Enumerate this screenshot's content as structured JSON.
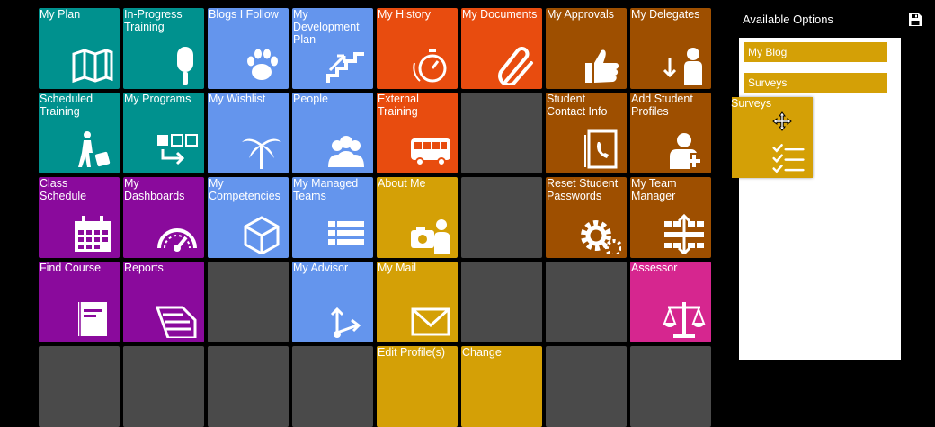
{
  "tiles": [
    {
      "id": "my-plan",
      "label": "My Plan",
      "color": "#00918e",
      "col": 0,
      "row": 0,
      "icon": "map-icon"
    },
    {
      "id": "in-progress-training",
      "label": "In-Progress Training",
      "color": "#00918e",
      "col": 1,
      "row": 0,
      "icon": "popsicle-icon"
    },
    {
      "id": "blogs-i-follow",
      "label": "Blogs I Follow",
      "color": "#6495ed",
      "col": 2,
      "row": 0,
      "icon": "paw-icon"
    },
    {
      "id": "my-development-plan",
      "label": "My Development Plan",
      "color": "#6495ed",
      "col": 3,
      "row": 0,
      "icon": "stairs-icon"
    },
    {
      "id": "my-history",
      "label": "My History",
      "color": "#e84c0f",
      "col": 4,
      "row": 0,
      "icon": "stopwatch-icon"
    },
    {
      "id": "my-documents",
      "label": "My Documents",
      "color": "#e84c0f",
      "col": 5,
      "row": 0,
      "icon": "paperclip-icon"
    },
    {
      "id": "my-approvals",
      "label": "My Approvals",
      "color": "#9e4f00",
      "col": 6,
      "row": 0,
      "icon": "thumbs-up-icon"
    },
    {
      "id": "my-delegates",
      "label": "My Delegates",
      "color": "#9e4f00",
      "col": 7,
      "row": 0,
      "icon": "person-download-icon"
    },
    {
      "id": "scheduled-training",
      "label": "Scheduled Training",
      "color": "#00918e",
      "col": 0,
      "row": 1,
      "icon": "traveler-icon"
    },
    {
      "id": "my-programs",
      "label": "My Programs",
      "color": "#00918e",
      "col": 1,
      "row": 1,
      "icon": "flow-boxes-icon"
    },
    {
      "id": "my-wishlist",
      "label": "My Wishlist",
      "color": "#6495ed",
      "col": 2,
      "row": 1,
      "icon": "palm-tree-icon"
    },
    {
      "id": "people",
      "label": "People",
      "color": "#6495ed",
      "col": 3,
      "row": 1,
      "icon": "people-icon"
    },
    {
      "id": "external-training",
      "label": "External Training",
      "color": "#e84c0f",
      "col": 4,
      "row": 1,
      "icon": "bus-icon"
    },
    {
      "id": "empty-1",
      "label": "",
      "color": "#4a4a4a",
      "col": 5,
      "row": 1,
      "icon": ""
    },
    {
      "id": "student-contact-info",
      "label": "Student Contact Info",
      "color": "#9e4f00",
      "col": 6,
      "row": 1,
      "icon": "address-book-icon"
    },
    {
      "id": "add-student-profiles",
      "label": "Add Student Profiles",
      "color": "#9e4f00",
      "col": 7,
      "row": 1,
      "icon": "add-person-icon"
    },
    {
      "id": "class-schedule",
      "label": "Class Schedule",
      "color": "#8a0a9c",
      "col": 0,
      "row": 2,
      "icon": "calendar-icon"
    },
    {
      "id": "my-dashboards",
      "label": "My Dashboards",
      "color": "#8a0a9c",
      "col": 1,
      "row": 2,
      "icon": "gauge-icon"
    },
    {
      "id": "my-competencies",
      "label": "My Competencies",
      "color": "#6495ed",
      "col": 2,
      "row": 2,
      "icon": "cube-icon"
    },
    {
      "id": "my-managed-teams",
      "label": "My Managed Teams",
      "color": "#6495ed",
      "col": 3,
      "row": 2,
      "icon": "list-icon"
    },
    {
      "id": "about-me",
      "label": "About Me",
      "color": "#d4a006",
      "col": 4,
      "row": 2,
      "icon": "camera-person-icon"
    },
    {
      "id": "empty-2",
      "label": "",
      "color": "#4a4a4a",
      "col": 5,
      "row": 2,
      "icon": ""
    },
    {
      "id": "reset-student-passwords",
      "label": "Reset Student Passwords",
      "color": "#9e4f00",
      "col": 6,
      "row": 2,
      "icon": "gears-icon"
    },
    {
      "id": "my-team-manager",
      "label": "My Team Manager",
      "color": "#9e4f00",
      "col": 7,
      "row": 2,
      "icon": "grid-arrows-icon"
    },
    {
      "id": "find-course",
      "label": "Find Course",
      "color": "#8a0a9c",
      "col": 0,
      "row": 3,
      "icon": "book-icon"
    },
    {
      "id": "reports",
      "label": "Reports",
      "color": "#8a0a9c",
      "col": 1,
      "row": 3,
      "icon": "report-icon"
    },
    {
      "id": "empty-3",
      "label": "",
      "color": "#4a4a4a",
      "col": 2,
      "row": 3,
      "icon": ""
    },
    {
      "id": "my-advisor",
      "label": "My Advisor",
      "color": "#6495ed",
      "col": 3,
      "row": 3,
      "icon": "branch-arrow-icon"
    },
    {
      "id": "my-mail",
      "label": "My Mail",
      "color": "#d4a006",
      "col": 4,
      "row": 3,
      "icon": "envelope-icon"
    },
    {
      "id": "empty-4",
      "label": "",
      "color": "#4a4a4a",
      "col": 5,
      "row": 3,
      "icon": ""
    },
    {
      "id": "empty-5",
      "label": "",
      "color": "#4a4a4a",
      "col": 6,
      "row": 3,
      "icon": ""
    },
    {
      "id": "assessor",
      "label": "Assessor",
      "color": "#d6268f",
      "col": 7,
      "row": 3,
      "icon": "scales-icon"
    },
    {
      "id": "empty-6",
      "label": "",
      "color": "#4a4a4a",
      "col": 0,
      "row": 4,
      "icon": ""
    },
    {
      "id": "empty-7",
      "label": "",
      "color": "#4a4a4a",
      "col": 1,
      "row": 4,
      "icon": ""
    },
    {
      "id": "empty-8",
      "label": "",
      "color": "#4a4a4a",
      "col": 2,
      "row": 4,
      "icon": ""
    },
    {
      "id": "empty-9",
      "label": "",
      "color": "#4a4a4a",
      "col": 3,
      "row": 4,
      "icon": ""
    },
    {
      "id": "edit-profiles",
      "label": "Edit Profile(s)",
      "color": "#d4a006",
      "col": 4,
      "row": 4,
      "icon": ""
    },
    {
      "id": "change",
      "label": "Change",
      "color": "#d4a006",
      "col": 5,
      "row": 4,
      "icon": ""
    },
    {
      "id": "empty-10",
      "label": "",
      "color": "#4a4a4a",
      "col": 6,
      "row": 4,
      "icon": ""
    },
    {
      "id": "empty-11",
      "label": "",
      "color": "#4a4a4a",
      "col": 7,
      "row": 4,
      "icon": ""
    }
  ],
  "panel": {
    "title": "Available Options",
    "save_icon": "save-icon",
    "options": [
      {
        "label": "My Blog"
      },
      {
        "label": "Surveys"
      }
    ]
  },
  "dragging": {
    "label": "Surveys",
    "icon": "checklist-icon",
    "cursor_icon": "move-icon"
  }
}
